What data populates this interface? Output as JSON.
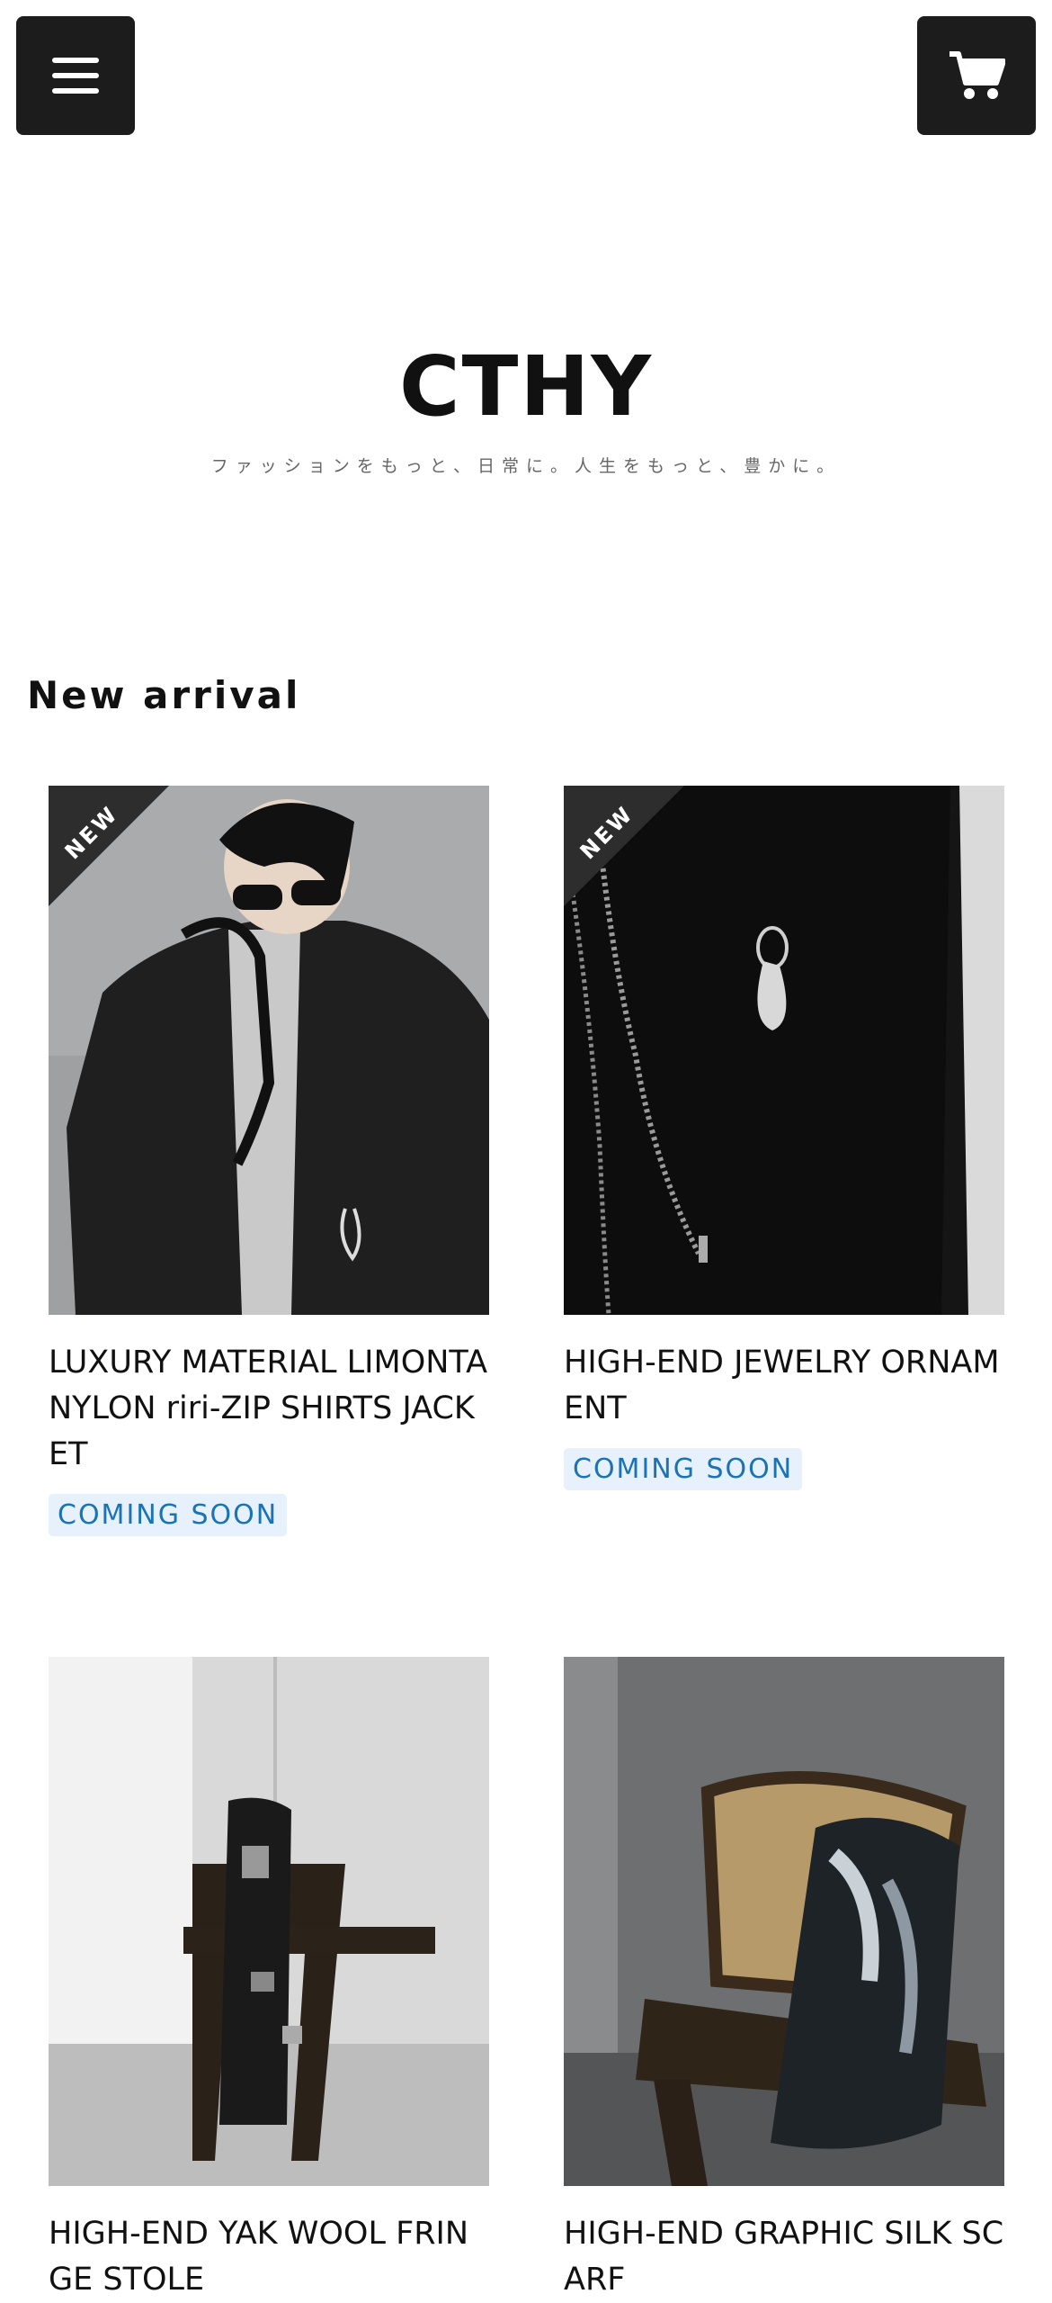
{
  "header": {
    "menu_icon": "hamburger-menu-icon",
    "cart_icon": "shopping-cart-icon"
  },
  "brand": {
    "logo": "CTHY",
    "tagline": "ファッションをもっと、日常に。人生をもっと、豊かに。"
  },
  "section": {
    "title": "New arrival"
  },
  "products": [
    {
      "badge": "NEW",
      "title": "LUXURY MATERIAL LIMONTA NYLON riri-ZIP SHIRTS JACKET",
      "status": "COMING SOON"
    },
    {
      "badge": "NEW",
      "title": "HIGH-END JEWELRY ORNAMENT",
      "status": "COMING SOON"
    },
    {
      "title": "HIGH-END YAK WOOL FRINGE STOLE"
    },
    {
      "title": "HIGH-END GRAPHIC SILK SCARF"
    }
  ]
}
